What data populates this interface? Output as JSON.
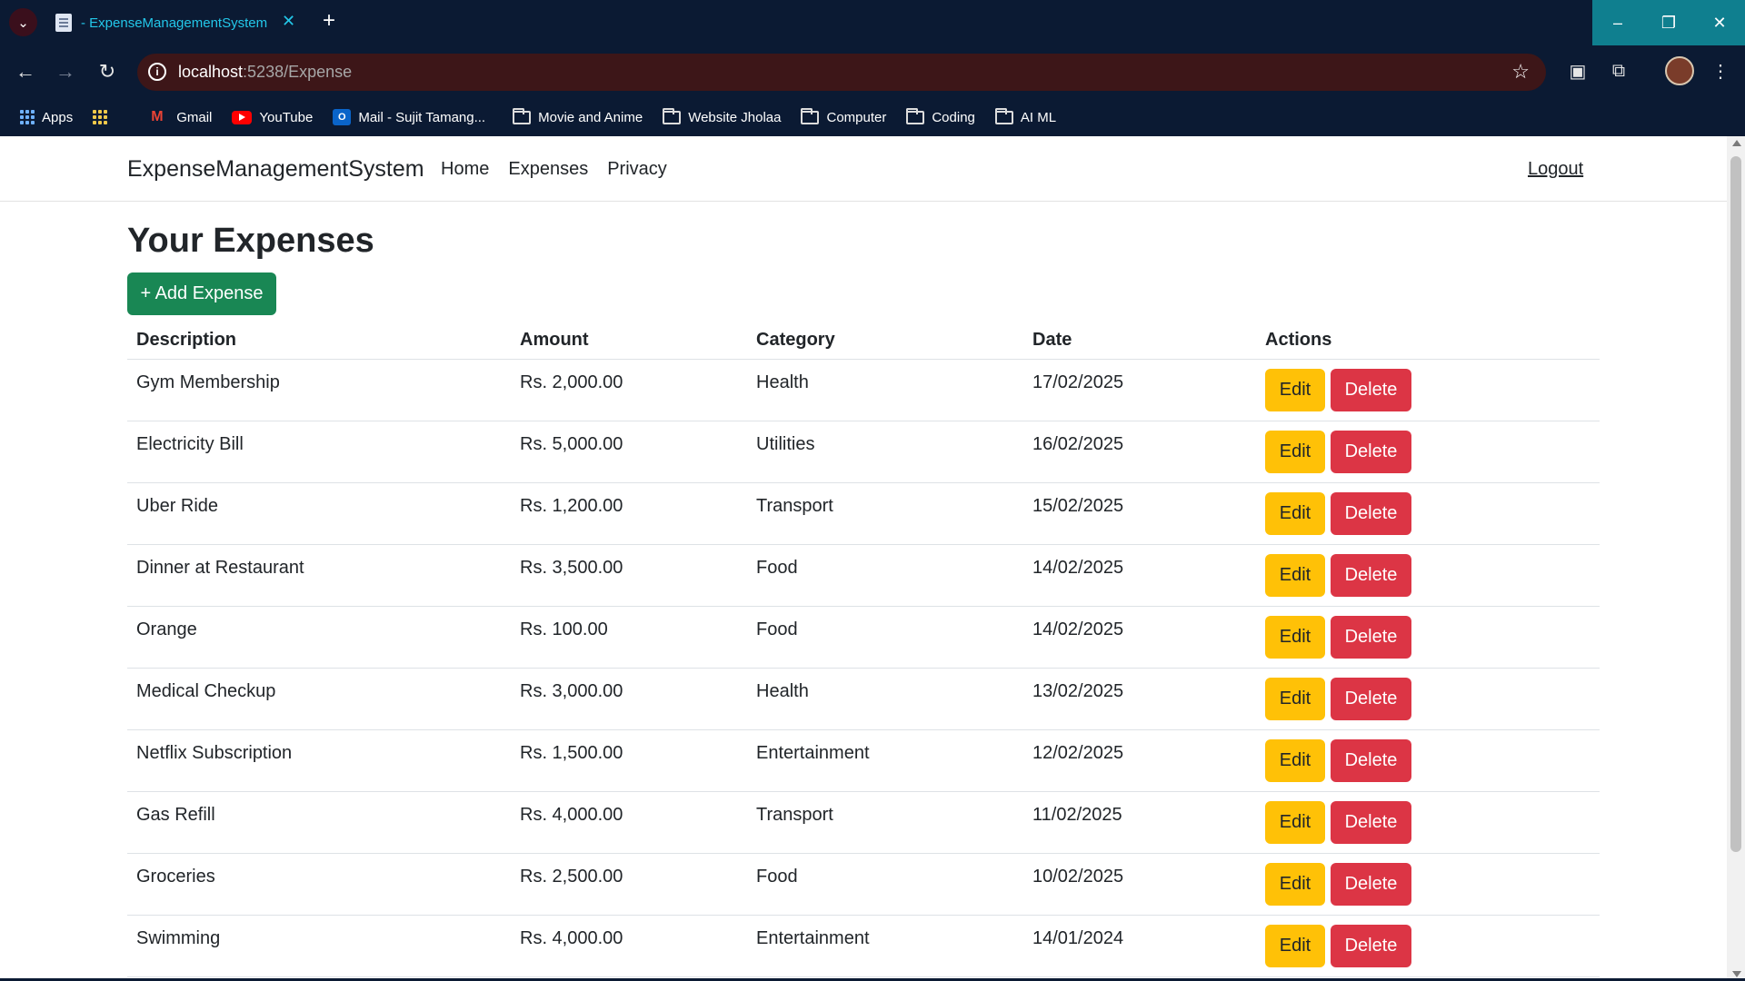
{
  "browser": {
    "tab_title": "- ExpenseManagementSystem",
    "url_host": "localhost",
    "url_path": ":5238/Expense",
    "bookmarks": [
      {
        "label": "Apps",
        "icon": "apps-grid-icon"
      },
      {
        "label": "",
        "icon": "apps-grid-alt-icon"
      },
      {
        "label": "Gmail",
        "icon": "gmail-icon"
      },
      {
        "label": "YouTube",
        "icon": "youtube-icon"
      },
      {
        "label": "Mail - Sujit Tamang...",
        "icon": "outlook-icon"
      },
      {
        "label": "Movie and Anime",
        "icon": "folder-icon"
      },
      {
        "label": "Website Jholaa",
        "icon": "folder-icon"
      },
      {
        "label": "Computer",
        "icon": "folder-icon"
      },
      {
        "label": "Coding",
        "icon": "folder-icon"
      },
      {
        "label": "AI ML",
        "icon": "folder-icon"
      }
    ]
  },
  "navbar": {
    "brand": "ExpenseManagementSystem",
    "links": [
      "Home",
      "Expenses",
      "Privacy"
    ],
    "logout": "Logout"
  },
  "main": {
    "heading": "Your Expenses",
    "add_button": "+ Add Expense",
    "columns": [
      "Description",
      "Amount",
      "Category",
      "Date",
      "Actions"
    ],
    "edit_label": "Edit",
    "delete_label": "Delete",
    "rows": [
      {
        "description": "Gym Membership",
        "amount": "Rs. 2,000.00",
        "category": "Health",
        "date": "17/02/2025"
      },
      {
        "description": "Electricity Bill",
        "amount": "Rs. 5,000.00",
        "category": "Utilities",
        "date": "16/02/2025"
      },
      {
        "description": "Uber Ride",
        "amount": "Rs. 1,200.00",
        "category": "Transport",
        "date": "15/02/2025"
      },
      {
        "description": "Dinner at Restaurant",
        "amount": "Rs. 3,500.00",
        "category": "Food",
        "date": "14/02/2025"
      },
      {
        "description": "Orange",
        "amount": "Rs. 100.00",
        "category": "Food",
        "date": "14/02/2025"
      },
      {
        "description": "Medical Checkup",
        "amount": "Rs. 3,000.00",
        "category": "Health",
        "date": "13/02/2025"
      },
      {
        "description": "Netflix Subscription",
        "amount": "Rs. 1,500.00",
        "category": "Entertainment",
        "date": "12/02/2025"
      },
      {
        "description": "Gas Refill",
        "amount": "Rs. 4,000.00",
        "category": "Transport",
        "date": "11/02/2025"
      },
      {
        "description": "Groceries",
        "amount": "Rs. 2,500.00",
        "category": "Food",
        "date": "10/02/2025"
      },
      {
        "description": "Swimming",
        "amount": "Rs. 4,000.00",
        "category": "Entertainment",
        "date": "14/01/2024"
      }
    ]
  },
  "colors": {
    "success": "#198754",
    "warning": "#ffc107",
    "danger": "#dc3545",
    "chrome_bg": "#0b1a33"
  }
}
